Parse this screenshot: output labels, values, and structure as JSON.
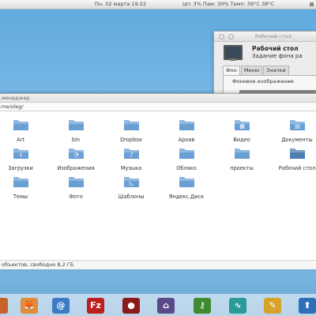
{
  "top_panel": {
    "clock": "Пн. 02 марта 19:22",
    "stats": "Цп: 3%  Пам: 30%  Темп: 39°C 38°C"
  },
  "settings_window": {
    "title": "Рабочий стол",
    "heading": "Рабочий стол",
    "subtitle": "Задание фона ра",
    "tabs": [
      {
        "label": "Фон",
        "active": true
      },
      {
        "label": "Меню",
        "active": false
      },
      {
        "label": "Значки",
        "active": false
      }
    ],
    "background_label": "Фоновое изображение"
  },
  "file_manager": {
    "title": "менеджер",
    "location": "me/oleg/",
    "status": "объектов, свободно 8,2 ГБ",
    "items": [
      {
        "name": "Art",
        "icon": "folder-icon",
        "color": "#6a9fd4"
      },
      {
        "name": "bin",
        "icon": "folder-icon",
        "color": "#6a9fd4"
      },
      {
        "name": "Dropbox",
        "icon": "folder-icon",
        "color": "#6a9fd4"
      },
      {
        "name": "Архив",
        "icon": "folder-icon",
        "color": "#6a9fd4"
      },
      {
        "name": "Видео",
        "icon": "video-folder-icon",
        "color": "#6a9fd4"
      },
      {
        "name": "Документы",
        "icon": "documents-folder-icon",
        "color": "#6a9fd4"
      },
      {
        "name": "Загрузки",
        "icon": "downloads-folder-icon",
        "color": "#6a9fd4"
      },
      {
        "name": "Изображения",
        "icon": "pictures-folder-icon",
        "color": "#6a9fd4"
      },
      {
        "name": "Музыка",
        "icon": "music-folder-icon",
        "color": "#6a9fd4"
      },
      {
        "name": "Облако",
        "icon": "folder-icon",
        "color": "#6a9fd4"
      },
      {
        "name": "проекты",
        "icon": "folder-icon",
        "color": "#6a9fd4"
      },
      {
        "name": "Рабочий стол",
        "icon": "desktop-folder-icon",
        "color": "#4d7fb0"
      },
      {
        "name": "Темы",
        "icon": "folder-icon",
        "color": "#6a9fd4"
      },
      {
        "name": "Фото",
        "icon": "folder-icon",
        "color": "#6a9fd4"
      },
      {
        "name": "Шаблоны",
        "icon": "templates-folder-icon",
        "color": "#6a9fd4"
      },
      {
        "name": "Яндекс.Диск",
        "icon": "folder-icon",
        "color": "#6a9fd4"
      }
    ]
  },
  "dock": {
    "items": [
      {
        "name": "partial-app-icon",
        "color": "#c8612a",
        "glyph": ""
      },
      {
        "name": "fox-app-icon",
        "color": "#e38a3c",
        "glyph": "🦊"
      },
      {
        "name": "mail-app-icon",
        "color": "#3d7bc4",
        "glyph": "@"
      },
      {
        "name": "filezilla-icon",
        "color": "#bf1f1f",
        "glyph": "Fz"
      },
      {
        "name": "transmission-icon",
        "color": "#8c1a1a",
        "glyph": "●"
      },
      {
        "name": "home-app-icon",
        "color": "#5a4a8a",
        "glyph": "⌂"
      },
      {
        "name": "keys-app-icon",
        "color": "#3f8a2f",
        "glyph": "⚷"
      },
      {
        "name": "system-monitor-icon",
        "color": "#2a9a9a",
        "glyph": "∿"
      },
      {
        "name": "paint-app-icon",
        "color": "#d6a22a",
        "glyph": "✎"
      },
      {
        "name": "upload-app-icon",
        "color": "#2f6fb8",
        "glyph": "⬆"
      }
    ]
  }
}
